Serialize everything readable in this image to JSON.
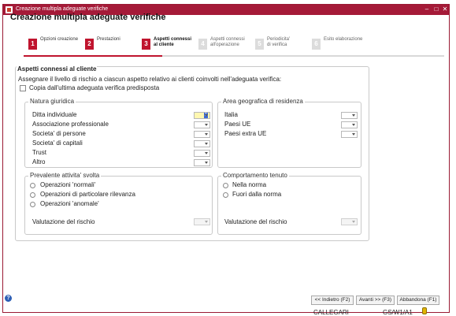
{
  "window": {
    "title": "Creazione multipla adeguate verifiche",
    "minimize": "–",
    "maximize": "□",
    "close": "✕"
  },
  "header": {
    "title": "Creazione multipla adeguate verifiche"
  },
  "steps": [
    {
      "num": "1",
      "label": "Opzioni creazione",
      "state": "done"
    },
    {
      "num": "2",
      "label": "Prestazioni",
      "state": "done"
    },
    {
      "num": "3",
      "label_line1": "Aspetti connessi",
      "label_line2": "al cliente",
      "state": "active"
    },
    {
      "num": "4",
      "label_line1": "Aspetti connessi",
      "label_line2": "all'operazione",
      "state": "pending"
    },
    {
      "num": "5",
      "label_line1": "Periodicita'",
      "label_line2": "di verifica",
      "state": "pending"
    },
    {
      "num": "6",
      "label": "Esito elaborazione",
      "state": "pending"
    }
  ],
  "panel": {
    "title": "Aspetti connessi al cliente",
    "instruction": "Assegnare il livello di rischio a ciascun aspetto relativo ai clienti coinvolti nell'adeguata verifica:",
    "copy_checkbox_label": "Copia dall'ultima adeguata verifica predisposta",
    "copy_checked": false
  },
  "natura": {
    "legend": "Natura giuridica",
    "items": [
      {
        "label": "Ditta individuale",
        "value": "1"
      },
      {
        "label": "Associazione professionale",
        "value": ""
      },
      {
        "label": "Societa' di persone",
        "value": ""
      },
      {
        "label": "Societa' di capitali",
        "value": ""
      },
      {
        "label": "Trust",
        "value": ""
      },
      {
        "label": "Altro",
        "value": ""
      }
    ]
  },
  "area": {
    "legend": "Area geografica di residenza",
    "items": [
      {
        "label": "Italia",
        "value": ""
      },
      {
        "label": "Paesi UE",
        "value": ""
      },
      {
        "label": "Paesi extra UE",
        "value": ""
      }
    ]
  },
  "attivita": {
    "legend": "Prevalente attivita' svolta",
    "options": [
      "Operazioni 'normali'",
      "Operazioni di particolare rilevanza",
      "Operazioni 'anomale'"
    ],
    "valutazione_label": "Valutazione del rischio"
  },
  "comportamento": {
    "legend": "Comportamento tenuto",
    "options": [
      "Nella norma",
      "Fuori dalla norma"
    ],
    "valutazione_label": "Valutazione del rischio"
  },
  "footer": {
    "help": "?",
    "back_button": "<< Indietro (F2)",
    "next_button": "Avanti >> (F3)",
    "abandon_button": "Abbandona (F1)"
  },
  "statusbar": {
    "user": "CALLEGARI",
    "code": "GS/W1/A1"
  },
  "colors": {
    "accent": "#c0142e",
    "titlebar": "#a51a38",
    "selected_combo": "#fff7b0"
  }
}
